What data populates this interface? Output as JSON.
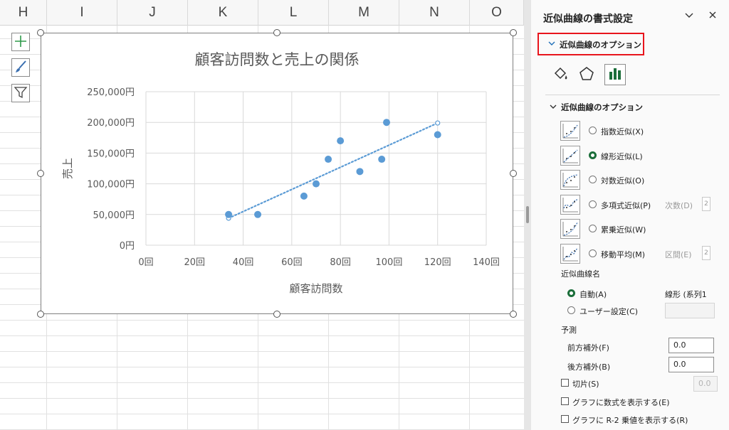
{
  "sheet": {
    "columns": [
      "H",
      "I",
      "J",
      "K",
      "L",
      "M",
      "N",
      "O"
    ]
  },
  "chart_data": {
    "type": "scatter",
    "title": "顧客訪問数と売上の関係",
    "xlabel": "顧客訪問数",
    "ylabel": "売上",
    "xlim": [
      0,
      140
    ],
    "ylim": [
      0,
      250000
    ],
    "x_ticks": [
      "0回",
      "20回",
      "40回",
      "60回",
      "80回",
      "100回",
      "120回",
      "140回"
    ],
    "y_ticks": [
      "0円",
      "50,000円",
      "100,000円",
      "150,000円",
      "200,000円",
      "250,000円"
    ],
    "points": [
      {
        "x": 34,
        "y": 50000
      },
      {
        "x": 46,
        "y": 50000
      },
      {
        "x": 65,
        "y": 80000
      },
      {
        "x": 70,
        "y": 100000
      },
      {
        "x": 75,
        "y": 140000
      },
      {
        "x": 80,
        "y": 170000
      },
      {
        "x": 88,
        "y": 120000
      },
      {
        "x": 97,
        "y": 140000
      },
      {
        "x": 99,
        "y": 200000
      },
      {
        "x": 120,
        "y": 180000
      }
    ],
    "trendline": {
      "type": "linear",
      "from": {
        "x": 34,
        "y": 44000
      },
      "to": {
        "x": 120,
        "y": 199000
      }
    },
    "grid": true,
    "series_color": "#5b9bd5"
  },
  "pane": {
    "title": "近似曲線の書式設定",
    "collapse_icon": "chevron-down-icon",
    "close_icon": "close-icon",
    "section_header": "近似曲線のオプション",
    "sub_section": "近似曲線のオプション",
    "options": [
      {
        "label": "指数近似(X)",
        "selected": false
      },
      {
        "label": "線形近似(L)",
        "selected": true
      },
      {
        "label": "対数近似(O)",
        "selected": false
      },
      {
        "label": "多項式近似(P)",
        "selected": false
      },
      {
        "label": "累乗近似(W)",
        "selected": false
      },
      {
        "label": "移動平均(M)",
        "selected": false
      }
    ],
    "order_label": "次数(D)",
    "order_value": "2",
    "period_label": "区間(E)",
    "period_value": "2",
    "name_section": "近似曲線名",
    "auto_label": "自動(A)",
    "auto_value": "線形 (系列1",
    "custom_label": "ユーザー設定(C)",
    "forecast_section": "予測",
    "forward_label": "前方補外(F)",
    "forward_value": "0.0",
    "backward_label": "後方補外(B)",
    "backward_value": "0.0",
    "intercept_label": "切片(S)",
    "intercept_value": "0.0",
    "show_equation_label": "グラフに数式を表示する(E)",
    "show_r2_label": "グラフに R-2 乗値を表示する(R)",
    "highlight_color": "#e8141c"
  }
}
